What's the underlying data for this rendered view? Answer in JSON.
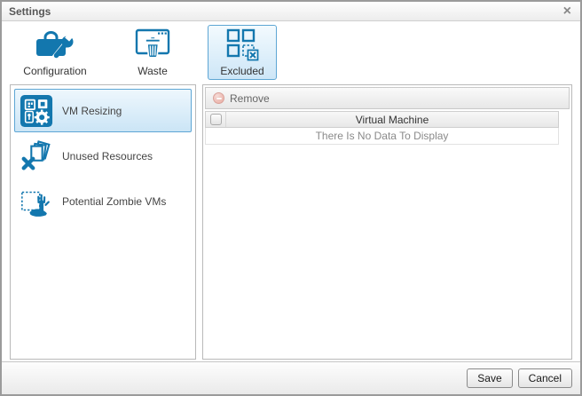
{
  "window": {
    "title": "Settings",
    "close_glyph": "×"
  },
  "ribbon": {
    "buttons": [
      {
        "id": "configuration",
        "label": "Configuration",
        "selected": false
      },
      {
        "id": "waste",
        "label": "Waste",
        "selected": false
      },
      {
        "id": "excluded",
        "label": "Excluded",
        "selected": true
      }
    ]
  },
  "sidebar": {
    "items": [
      {
        "id": "vm-resizing",
        "label": "VM Resizing",
        "selected": true
      },
      {
        "id": "unused-resources",
        "label": "Unused Resources",
        "selected": false
      },
      {
        "id": "potential-zombie-vms",
        "label": "Potential Zombie VMs",
        "selected": false
      }
    ]
  },
  "main": {
    "toolbar": {
      "remove_label": "Remove"
    },
    "table": {
      "columns": [
        "Virtual Machine"
      ],
      "empty_text": "There Is No Data To Display",
      "select_all_checked": false
    }
  },
  "footer": {
    "save_label": "Save",
    "cancel_label": "Cancel"
  },
  "colors": {
    "accent": "#1377AE",
    "selected_border": "#5EA6D4",
    "selected_bg_top": "#F0F8FE",
    "selected_bg_bottom": "#C9E4F6",
    "remove_icon_pink": "#E9A99F"
  }
}
